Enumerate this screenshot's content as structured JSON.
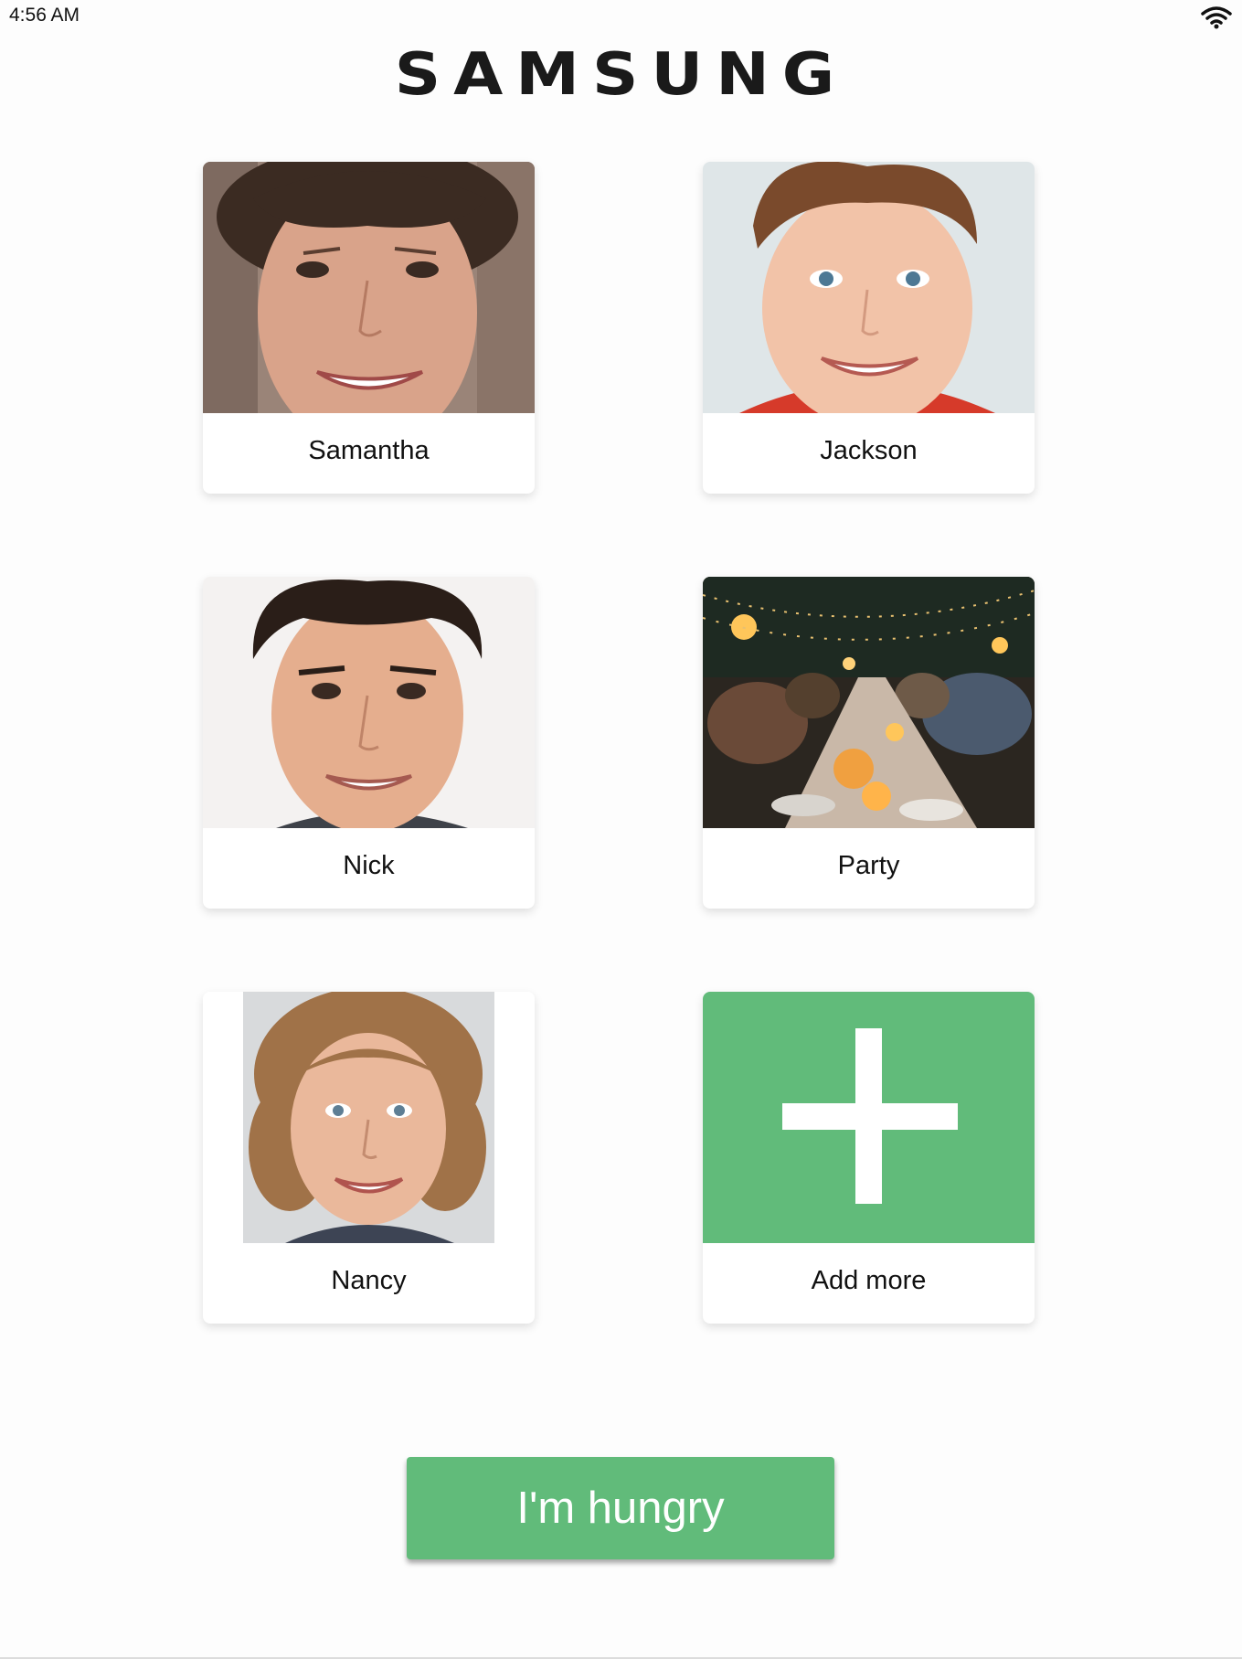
{
  "status_bar": {
    "time": "4:56 AM",
    "wifi_icon": "wifi-icon"
  },
  "header": {
    "logo_text": "SAMSUNG"
  },
  "cards": [
    {
      "label": "Samantha",
      "image": "portrait-photo"
    },
    {
      "label": "Jackson",
      "image": "portrait-photo"
    },
    {
      "label": "Nick",
      "image": "portrait-photo"
    },
    {
      "label": "Party",
      "image": "party-photo"
    },
    {
      "label": "Nancy",
      "image": "portrait-photo"
    },
    {
      "label": "Add more",
      "image": "plus-icon"
    }
  ],
  "primary_button": {
    "label": "I'm hungry"
  },
  "colors": {
    "accent_green": "#61bb7a",
    "background": "#fdfdfd"
  }
}
